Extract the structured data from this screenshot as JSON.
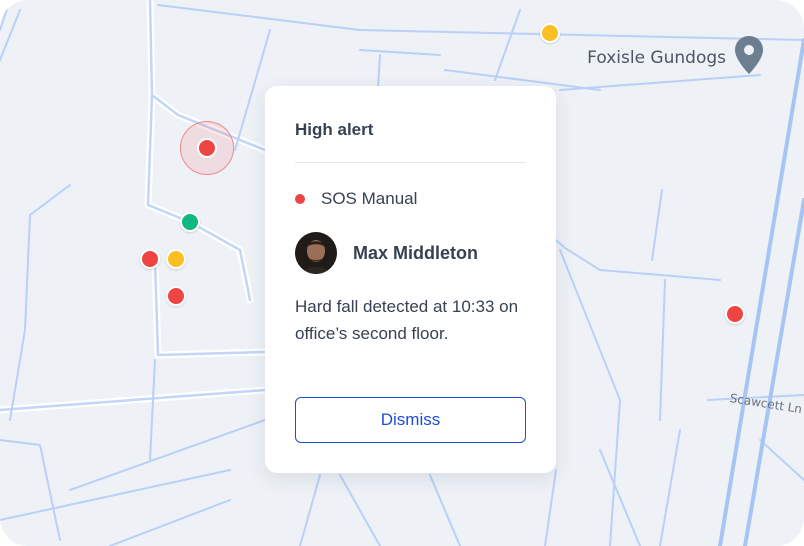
{
  "map": {
    "place_label": "Foxisle Gundogs",
    "place_icon": "location-pin-icon",
    "road_label": "Scawcett Ln",
    "colors": {
      "background": "#eef2f7",
      "road": "#b9d0f7",
      "road_outline": "#ffffff",
      "highway": "#a6c4f4"
    }
  },
  "markers": [
    {
      "status": "alert",
      "color": "#ef4444",
      "selected": true
    },
    {
      "status": "warning",
      "color": "#fbbf24"
    },
    {
      "status": "ok",
      "color": "#10b981"
    },
    {
      "status": "alert",
      "color": "#ef4444"
    },
    {
      "status": "warning",
      "color": "#fbbf24"
    },
    {
      "status": "alert",
      "color": "#ef4444"
    },
    {
      "status": "alert",
      "color": "#ef4444"
    }
  ],
  "alert": {
    "title": "High alert",
    "type_label": "SOS Manual",
    "type_color": "#ef4444",
    "user_name": "Max Middleton",
    "message": "Hard fall detected at 10:33 on office’s second floor.",
    "dismiss_label": "Dismiss",
    "accent_color": "#1d4ed8"
  }
}
